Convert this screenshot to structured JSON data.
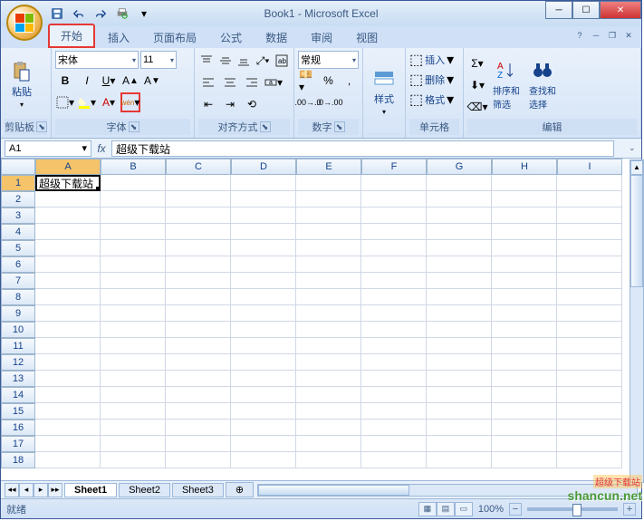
{
  "title": "Book1 - Microsoft Excel",
  "tabs": [
    "开始",
    "插入",
    "页面布局",
    "公式",
    "数据",
    "审阅",
    "视图"
  ],
  "active_tab": 0,
  "groups": {
    "clipboard": {
      "label": "剪贴板",
      "paste": "粘贴"
    },
    "font": {
      "label": "字体",
      "font_name": "宋体",
      "font_size": "11",
      "phonetic": "wén"
    },
    "alignment": {
      "label": "对齐方式"
    },
    "number": {
      "label": "数字",
      "format": "常规"
    },
    "styles": {
      "label": "样式",
      "btn": "样式"
    },
    "cells": {
      "label": "单元格",
      "insert": "插入",
      "delete": "删除",
      "format": "格式"
    },
    "editing": {
      "label": "编辑",
      "sort": "排序和\n筛选",
      "find": "查找和\n选择"
    }
  },
  "name_box": "A1",
  "formula_value": "超级下载站",
  "cell_a1": "超级下载站",
  "columns": [
    "A",
    "B",
    "C",
    "D",
    "E",
    "F",
    "G",
    "H",
    "I"
  ],
  "rows": [
    1,
    2,
    3,
    4,
    5,
    6,
    7,
    8,
    9,
    10,
    11,
    12,
    13,
    14,
    15,
    16,
    17,
    18
  ],
  "sheets": [
    "Sheet1",
    "Sheet2",
    "Sheet3"
  ],
  "status": "就绪",
  "zoom": "100%",
  "watermark": "shancun.net",
  "watermark_top": "超级下载站"
}
